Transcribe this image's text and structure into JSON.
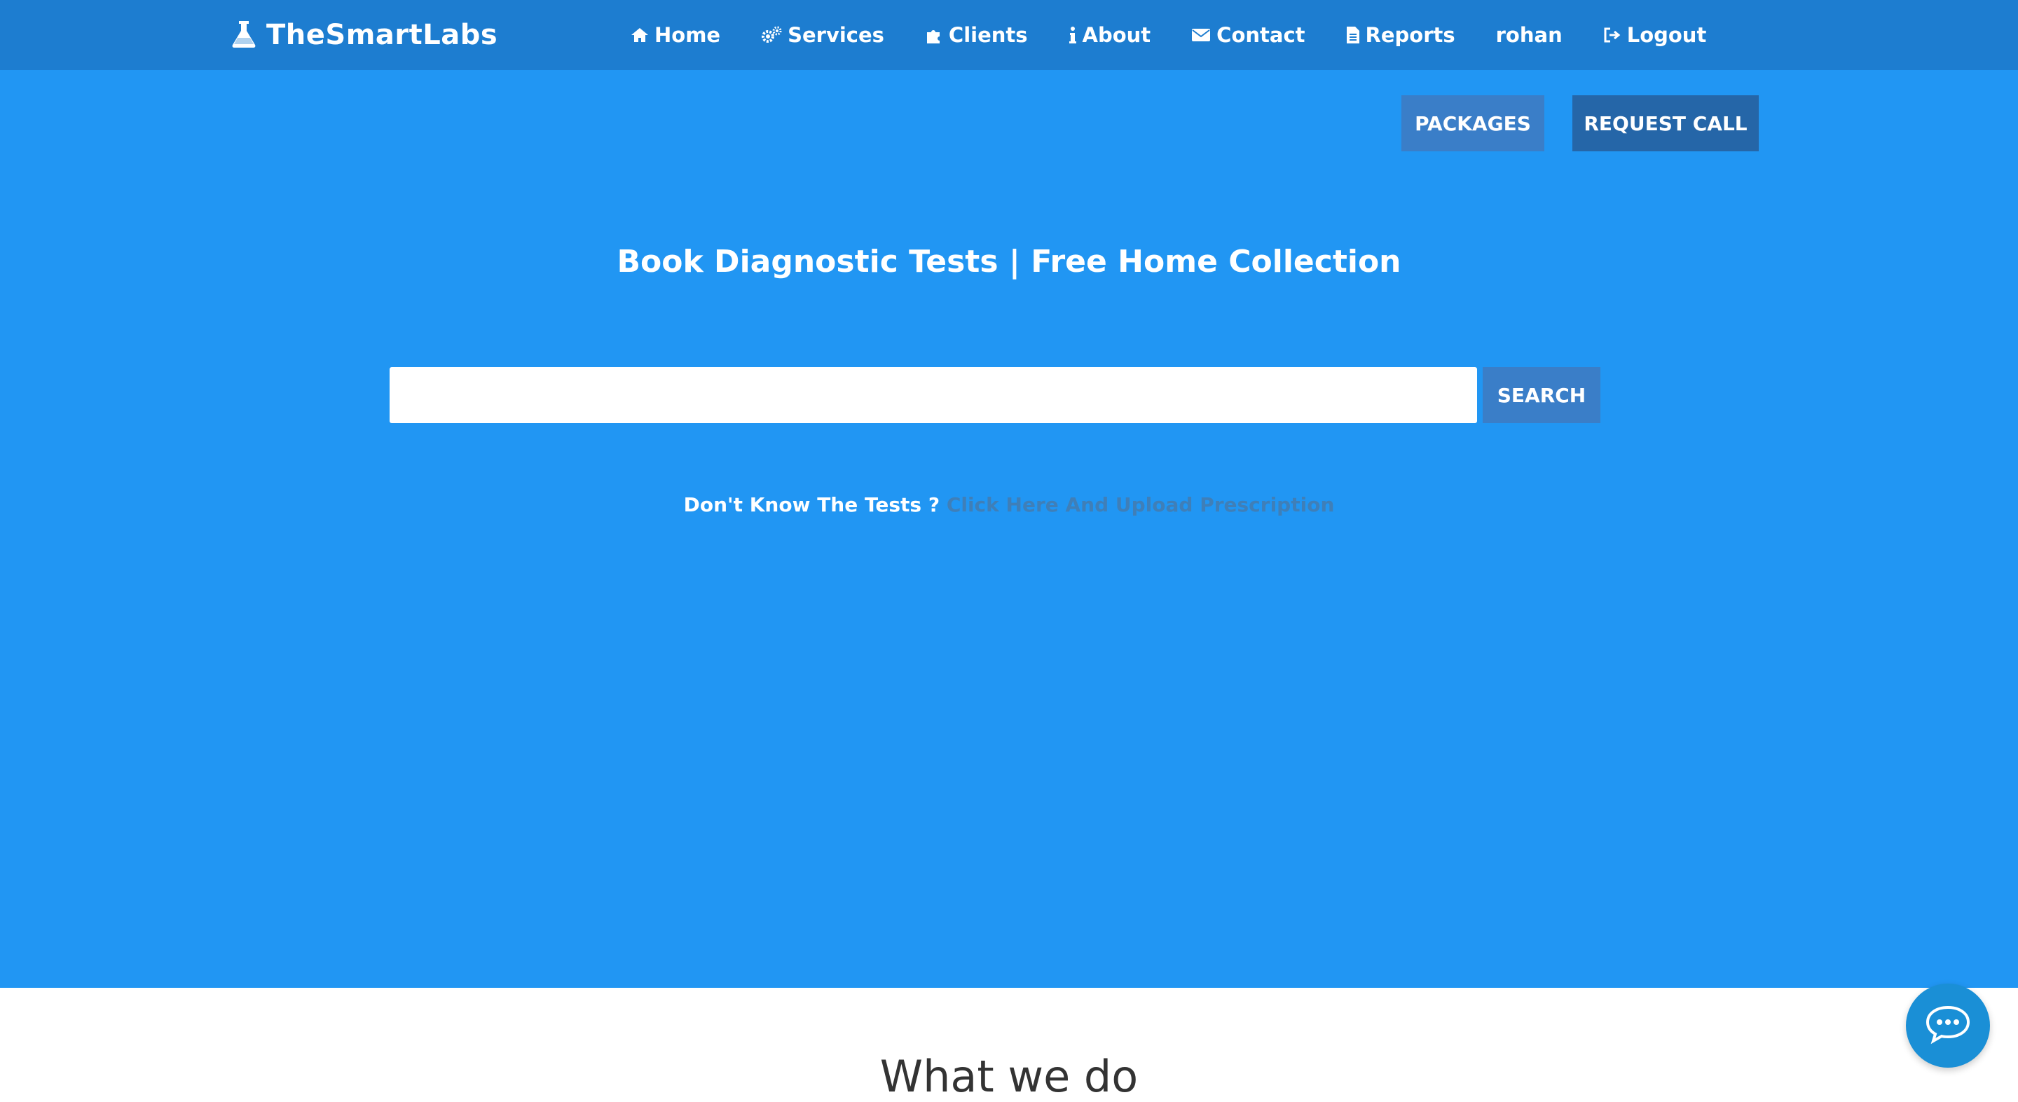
{
  "brand": {
    "name": "TheSmartLabs",
    "icon": "flask-icon"
  },
  "nav": {
    "items": [
      {
        "label": "Home",
        "icon": "home-icon"
      },
      {
        "label": "Services",
        "icon": "gears-icon"
      },
      {
        "label": "Clients",
        "icon": "puzzle-icon"
      },
      {
        "label": "About",
        "icon": "info-icon"
      },
      {
        "label": "Contact",
        "icon": "envelope-icon"
      },
      {
        "label": "Reports",
        "icon": "document-icon"
      },
      {
        "label": "rohan",
        "icon": ""
      },
      {
        "label": "Logout",
        "icon": "logout-icon"
      }
    ]
  },
  "hero": {
    "packages_label": "PACKAGES",
    "request_call_label": "REQUEST CALL",
    "headline": "Book Diagnostic Tests | Free Home Collection",
    "search": {
      "value": "",
      "placeholder": "",
      "button_label": "SEARCH"
    },
    "prompt_text": "Don't Know The Tests ?",
    "upload_link_text": "Click Here And Upload Prescription"
  },
  "section": {
    "title": "What we do"
  },
  "chat": {
    "icon": "chat-bubble-icon"
  },
  "colors": {
    "header_bg": "#1d7dd0",
    "hero_bg": "#2196f3",
    "packages_bg": "#3a7ec8",
    "request_call_bg": "#2566a8",
    "link_color": "#3f7fb8",
    "chat_bg": "#1a8fd6"
  }
}
